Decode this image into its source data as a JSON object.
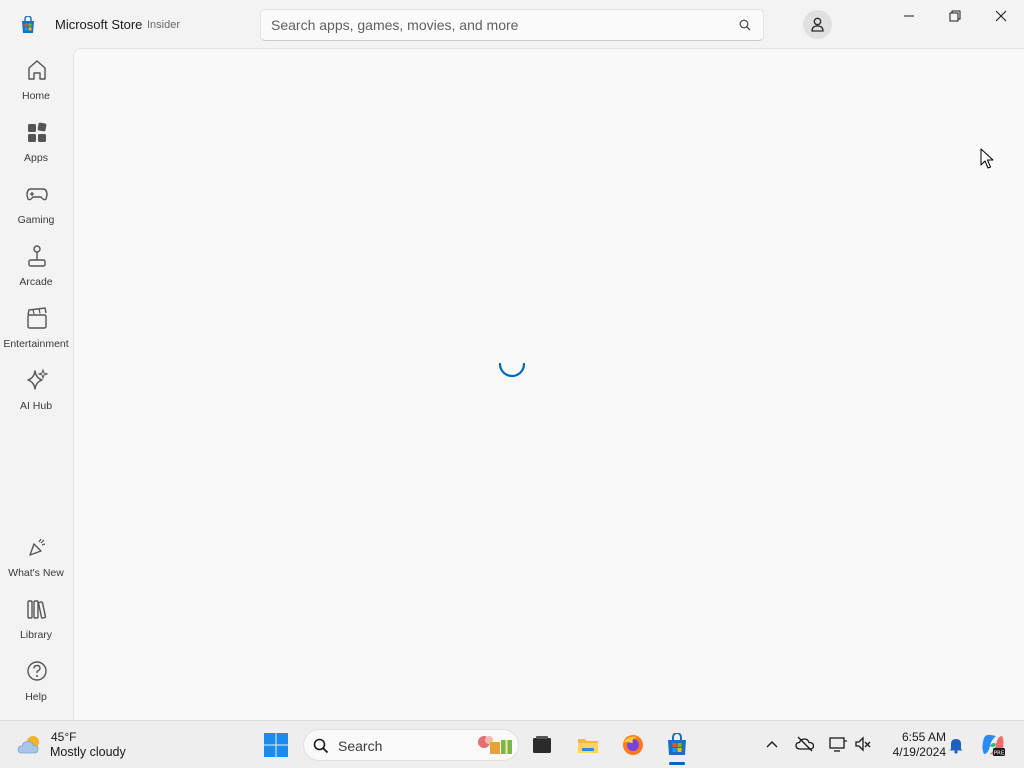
{
  "app": {
    "title": "Microsoft Store",
    "badge": "Insider"
  },
  "search": {
    "placeholder": "Search apps, games, movies, and more",
    "icon": "search-icon"
  },
  "window_controls": [
    "minimize",
    "restore",
    "close"
  ],
  "sidebar": {
    "items": [
      {
        "label": "Home",
        "icon": "home-icon"
      },
      {
        "label": "Apps",
        "icon": "apps-icon"
      },
      {
        "label": "Gaming",
        "icon": "gamepad-icon"
      },
      {
        "label": "Arcade",
        "icon": "joystick-icon"
      },
      {
        "label": "Entertainment",
        "icon": "clapperboard-icon"
      },
      {
        "label": "AI Hub",
        "icon": "sparkle-icon"
      }
    ],
    "bottom_items": [
      {
        "label": "What's New",
        "icon": "megaphone-icon"
      },
      {
        "label": "Library",
        "icon": "library-icon"
      },
      {
        "label": "Help",
        "icon": "help-icon"
      }
    ]
  },
  "main": {
    "state": "loading"
  },
  "taskbar": {
    "weather": {
      "temp": "45°F",
      "condition": "Mostly cloudy"
    },
    "search_label": "Search",
    "apps": [
      "start-icon",
      "file-explorer-icon",
      "folder-icon",
      "firefox-icon",
      "microsoft-store-icon"
    ],
    "clock": {
      "time": "6:55 AM",
      "date": "4/19/2024"
    }
  },
  "colors": {
    "accent": "#0067c0",
    "background": "#f3f3f3",
    "content": "#f9f9f9"
  }
}
